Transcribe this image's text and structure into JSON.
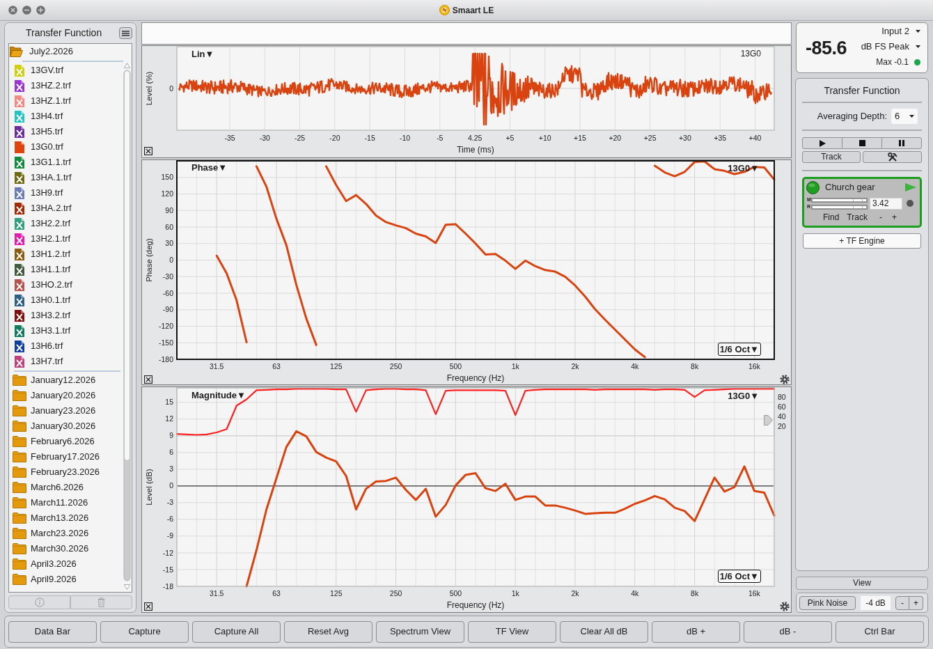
{
  "window": {
    "title": "Smaart LE"
  },
  "sidebar": {
    "title": "Transfer Function",
    "tree": [
      {
        "label": "July2.2026",
        "expanded": true,
        "children": [
          {
            "label": "13GV.trf",
            "color": "#cfcf10",
            "visible": false
          },
          {
            "label": "13HZ.2.trf",
            "color": "#9a35d0",
            "visible": false
          },
          {
            "label": "13HZ.1.trf",
            "color": "#f28a84",
            "visible": false
          },
          {
            "label": "13H4.trf",
            "color": "#22c4c4",
            "visible": false
          },
          {
            "label": "13H5.trf",
            "color": "#6b2c9c",
            "visible": false
          },
          {
            "label": "13G0.trf",
            "color": "#e0440e",
            "visible": true
          },
          {
            "label": "13G1.1.trf",
            "color": "#0f8a3c",
            "visible": false
          },
          {
            "label": "13HA.1.trf",
            "color": "#6e6a10",
            "visible": false
          },
          {
            "label": "13H9.trf",
            "color": "#6a7cb4",
            "visible": false
          },
          {
            "label": "13HA.2.trf",
            "color": "#a32a06",
            "visible": false
          },
          {
            "label": "13H2.2.trf",
            "color": "#32a07e",
            "visible": false
          },
          {
            "label": "13H2.1.trf",
            "color": "#e01fae",
            "visible": false
          },
          {
            "label": "13H1.2.trf",
            "color": "#8a5c10",
            "visible": false
          },
          {
            "label": "13H1.1.trf",
            "color": "#3f5a3c",
            "visible": false
          },
          {
            "label": "13HO.2.trf",
            "color": "#b4524e",
            "visible": false
          },
          {
            "label": "13H0.1.trf",
            "color": "#2f5f86",
            "visible": false
          },
          {
            "label": "13H3.2.trf",
            "color": "#7e0f0c",
            "visible": false
          },
          {
            "label": "13H3.1.trf",
            "color": "#0f7a5c",
            "visible": false
          },
          {
            "label": "13H6.trf",
            "color": "#0e3f9e",
            "visible": false
          },
          {
            "label": "13H7.trf",
            "color": "#c0407c",
            "visible": false
          }
        ]
      },
      {
        "label": "January12.2026",
        "expanded": false
      },
      {
        "label": "January20.2026",
        "expanded": false
      },
      {
        "label": "January23.2026",
        "expanded": false
      },
      {
        "label": "January30.2026",
        "expanded": false
      },
      {
        "label": "February6.2026",
        "expanded": false
      },
      {
        "label": "February17.2026",
        "expanded": false
      },
      {
        "label": "February23.2026",
        "expanded": false
      },
      {
        "label": "March6.2026",
        "expanded": false
      },
      {
        "label": "March11.2026",
        "expanded": false
      },
      {
        "label": "March13.2026",
        "expanded": false
      },
      {
        "label": "March23.2026",
        "expanded": false
      },
      {
        "label": "March30.2026",
        "expanded": false
      },
      {
        "label": "April3.2026",
        "expanded": false
      },
      {
        "label": "April9.2026",
        "expanded": false
      }
    ],
    "footer_buttons": [
      {
        "kind": "info",
        "disabled": true
      },
      {
        "kind": "delete",
        "disabled": true
      }
    ]
  },
  "impulse_panel": {
    "selected": false,
    "scale_label": "Lin▼",
    "trace_label": "13G0",
    "y_axis_title": "Level (%)",
    "y_tick": "0",
    "x_ticks": [
      "-35",
      "-30",
      "-25",
      "-20",
      "-15",
      "-10",
      "-5",
      "4.25",
      "+5",
      "+10",
      "+15",
      "+20",
      "+25",
      "+30",
      "+35",
      "+40"
    ],
    "x_axis_title": "Time (ms)"
  },
  "phase_panel": {
    "selected": true,
    "scale_label": "Phase▼",
    "trace_label": "13G0▼",
    "smoothing": "1/6 Oct▼",
    "chart_data": {
      "type": "line",
      "xlabel": "Frequency (Hz)",
      "ylabel": "Phase (deg)",
      "categories": [
        null,
        null,
        null,
        null,
        "31.5",
        null,
        null,
        null,
        null,
        null,
        "63",
        null,
        null,
        null,
        null,
        null,
        "125",
        null,
        null,
        null,
        null,
        null,
        "250",
        null,
        null,
        null,
        null,
        null,
        "500",
        null,
        null,
        null,
        null,
        null,
        "1k",
        null,
        null,
        null,
        null,
        null,
        "2k",
        null,
        null,
        null,
        null,
        null,
        "4k",
        null,
        null,
        null,
        null,
        null,
        "8k",
        null,
        null,
        null,
        null,
        null,
        "16k",
        null,
        null
      ],
      "series": [
        {
          "color": "#d8430f",
          "values": [
            null,
            null,
            null,
            null,
            8,
            -24,
            -73,
            -149,
            170,
            133,
            75,
            27,
            -45,
            -106,
            -154,
            170,
            136,
            107,
            118,
            102,
            81,
            69,
            63,
            58,
            48,
            43,
            31,
            64,
            65,
            48,
            30,
            10,
            11,
            -1,
            -16,
            -1,
            -11,
            -18,
            -21,
            -30,
            -46,
            -66,
            -89,
            -108,
            -126,
            -144,
            -162,
            -176,
            171,
            159,
            152,
            160,
            178,
            179,
            165,
            162,
            156,
            160,
            169,
            168,
            146
          ]
        }
      ],
      "ylim": [
        -180,
        180
      ],
      "yticks": [
        150,
        120,
        90,
        60,
        30,
        0,
        -30,
        -60,
        -90,
        -120,
        -150,
        -180
      ],
      "grid": true
    }
  },
  "magnitude_panel": {
    "selected": false,
    "scale_label": "Magnitude▼",
    "trace_label": "13G0▼",
    "smoothing": "1/6 Oct▼",
    "chart_data": {
      "type": "line",
      "xlabel": "Frequency (Hz)",
      "ylabel": "Level (dB)",
      "categories": [
        null,
        null,
        null,
        null,
        "31.5",
        null,
        null,
        null,
        null,
        null,
        "63",
        null,
        null,
        null,
        null,
        null,
        "125",
        null,
        null,
        null,
        null,
        null,
        "250",
        null,
        null,
        null,
        null,
        null,
        "500",
        null,
        null,
        null,
        null,
        null,
        "1k",
        null,
        null,
        null,
        null,
        null,
        "2k",
        null,
        null,
        null,
        null,
        null,
        "4k",
        null,
        null,
        null,
        null,
        null,
        "8k",
        null,
        null,
        null,
        null,
        null,
        "16k",
        null,
        null
      ],
      "series": [
        {
          "color": "#d8430f",
          "values": [
            null,
            null,
            null,
            null,
            null,
            null,
            null,
            -18,
            -11.5,
            -4.2,
            1.4,
            7.0,
            9.8,
            8.9,
            6.1,
            5.1,
            4.4,
            1.8,
            -4.2,
            -0.5,
            0.8,
            0.9,
            1.5,
            -0.7,
            -2.5,
            -0.5,
            -5.5,
            -3.4,
            0.1,
            2.0,
            2.3,
            -0.4,
            -0.9,
            0.4,
            -2.5,
            -1.9,
            -1.9,
            -3.5,
            -3.5,
            -3.9,
            -4.4,
            -5.0,
            -4.9,
            -4.8,
            -4.8,
            -4.1,
            -3.2,
            -2.6,
            -1.8,
            -2.4,
            -3.9,
            -4.5,
            -6.3,
            -2.4,
            1.5,
            -1.0,
            -0.2,
            3.5,
            -0.9,
            -1.2,
            -5.3
          ]
        }
      ],
      "ylim": [
        -18,
        17.6
      ],
      "yticks": [
        15,
        12,
        9,
        6,
        3,
        0,
        -3,
        -6,
        -9,
        -12,
        -15,
        -18
      ],
      "grid": true
    },
    "coherence": {
      "chart_data": {
        "type": "line",
        "categories": [
          null,
          null,
          null,
          null,
          null,
          null,
          null,
          null,
          null,
          null,
          null,
          null,
          null,
          null,
          null,
          null,
          null,
          null,
          null,
          null,
          null,
          null,
          null,
          null,
          null,
          null,
          null,
          null,
          null,
          null,
          null,
          null,
          null,
          null,
          null,
          null,
          null,
          null,
          null,
          null,
          null,
          null,
          null,
          null,
          null,
          null,
          null,
          null,
          null,
          null,
          null,
          null,
          null,
          null,
          null,
          null,
          null,
          null,
          null,
          null,
          null
        ],
        "series": [
          {
            "color": "#ff1f1f",
            "values": [
              4,
              3,
              2,
              3,
              7,
              14,
              63,
              76,
              95,
              96,
              97,
              97,
              98,
              98,
              98,
              98,
              97,
              97,
              50,
              95,
              97,
              98,
              98,
              97,
              97,
              95,
              45,
              94,
              95,
              95,
              95,
              95,
              95,
              94,
              43,
              94,
              96,
              97,
              97,
              97,
              97,
              97,
              96,
              97,
              97,
              97,
              97,
              97,
              96,
              97,
              97,
              96,
              81,
              95,
              96,
              97,
              98,
              98,
              98,
              98,
              98
            ]
          }
        ],
        "ylim": [
          0,
          100
        ],
        "yticks": [
          80,
          60,
          40,
          20
        ]
      }
    }
  },
  "meter": {
    "reading": "-85.6",
    "input": "Input 2",
    "scale": "dB FS Peak",
    "max": "Max -0.1"
  },
  "control_panel": {
    "title": "Transfer Function",
    "averaging_label": "Averaging Depth:",
    "averaging_value": "6",
    "track_button": "Track",
    "engine": {
      "on": true,
      "name": "Church gear",
      "meters": [
        {
          "label": "M",
          "level": 1
        },
        {
          "label": "R",
          "level": 1
        }
      ],
      "delay": "3.42",
      "buttons": [
        "Find",
        "Track",
        "-",
        "+"
      ]
    },
    "add_engine_button": "+ TF Engine"
  },
  "view_button": "View",
  "generator": {
    "label": "Pink Noise",
    "gain": "-4 dB",
    "steppers": [
      "-",
      "+"
    ]
  },
  "toolbar": [
    "Data Bar",
    "Capture",
    "Capture All",
    "Reset Avg",
    "Spectrum View",
    "TF View",
    "Clear All dB",
    "dB +",
    "dB -",
    "Ctrl Bar"
  ]
}
